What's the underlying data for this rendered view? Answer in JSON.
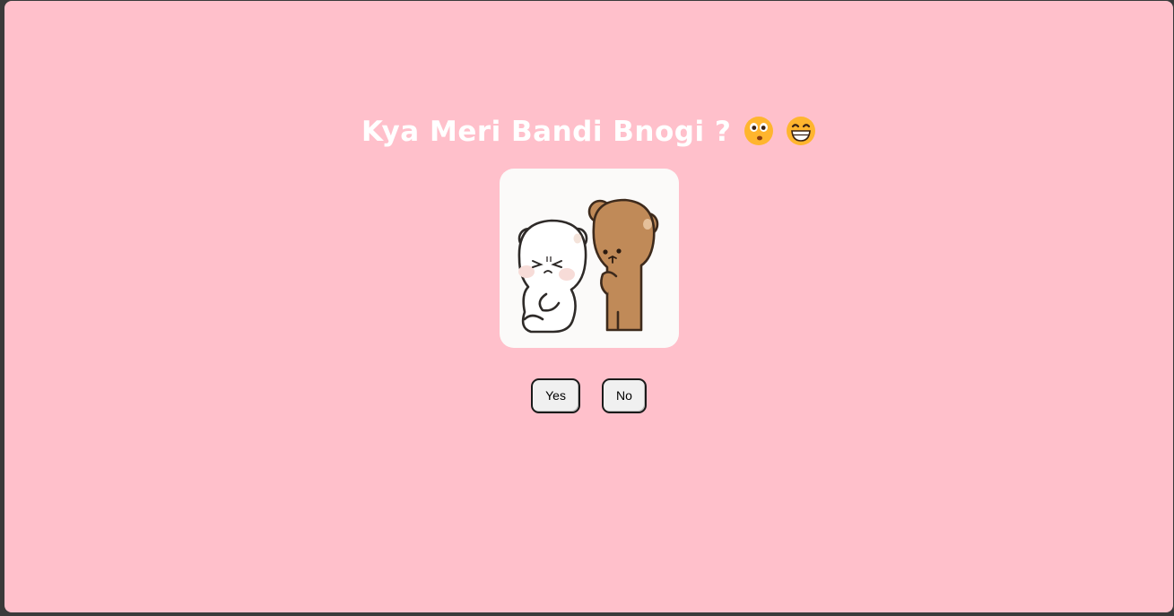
{
  "page": {
    "background": "#ffc0cb",
    "title": "Kya Meri Bandi Bnogi ?",
    "title_emojis": [
      "hushed-face-emoji",
      "grinning-face-emoji"
    ]
  },
  "image": {
    "alt": "two cartoon bears",
    "icon": "bears-illustration"
  },
  "buttons": {
    "yes_label": "Yes",
    "no_label": "No"
  }
}
